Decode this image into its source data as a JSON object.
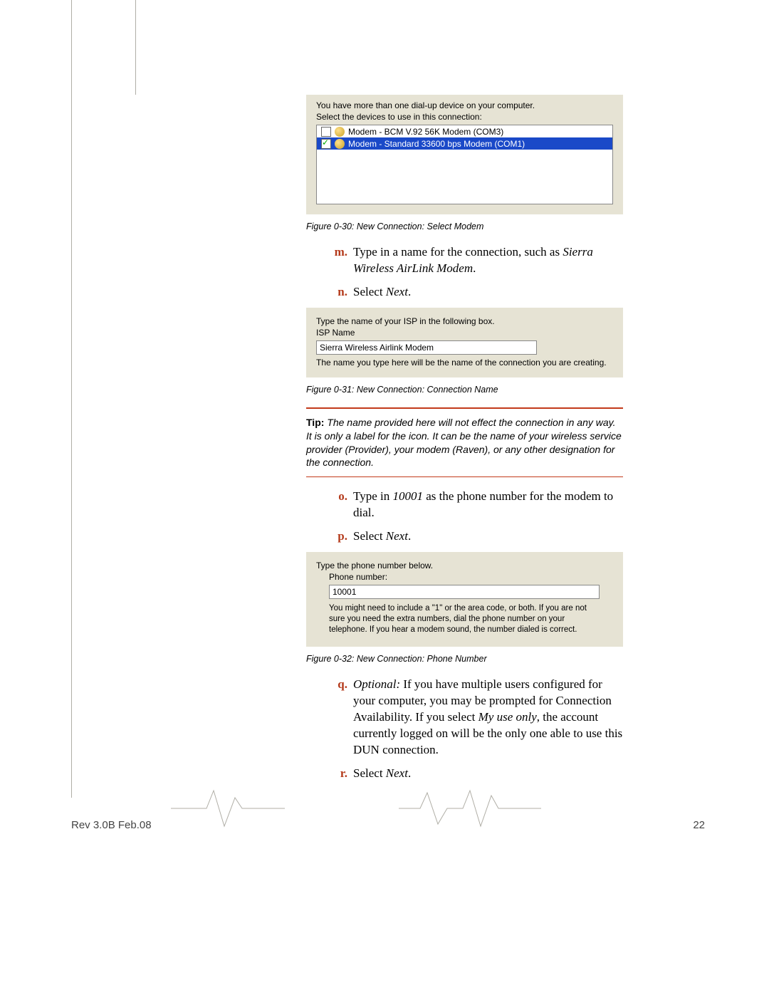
{
  "dlg1": {
    "line1": "You have more than one dial-up device on your computer.",
    "line2": "Select the devices to use in this connection:",
    "modem_a": "Modem - BCM V.92 56K Modem (COM3)",
    "modem_b": "Modem - Standard 33600 bps Modem (COM1)"
  },
  "cap30": "Figure 0-30: New Connection: Select Modem",
  "step_m_b": "m.",
  "step_m_t1": "Type in a name for the connection, such as ",
  "step_m_t2": "Sierra Wireless AirLink Modem",
  "step_m_t3": ".",
  "step_n_b": "n.",
  "step_n_t1": "Select ",
  "step_n_t2": "Next",
  "step_n_t3": ".",
  "dlg2": {
    "line1": "Type the name of your ISP in the following box.",
    "label": "ISP Name",
    "value": "Sierra Wireless Airlink Modem",
    "line2": "The name you type here will be the name of the connection you are creating."
  },
  "cap31": "Figure 0-31: New Connection: Connection Name",
  "tip_b": "Tip:",
  "tip_t": "The name provided here will not effect the connection in any way. It is only a label for the icon. It can be the name of your wireless service provider (Provider), your modem (Raven), or any other designation for the connection.",
  "step_o_b": "o.",
  "step_o_t1": "Type in ",
  "step_o_t2": "10001",
  "step_o_t3": " as the phone number for the modem to dial.",
  "step_p_b": "p.",
  "step_p_t1": "Select ",
  "step_p_t2": "Next",
  "step_p_t3": ".",
  "dlg3": {
    "line1": "Type the phone number below.",
    "label": "Phone number:",
    "value": "10001",
    "hint": "You might need to include a \"1\" or the area code, or both. If you are not sure you need the extra numbers, dial the phone number on your telephone. If you hear a modem sound, the number dialed is correct."
  },
  "cap32": "Figure 0-32: New Connection: Phone Number",
  "step_q_b": "q.",
  "step_q_t1": "Optional:",
  "step_q_t2": " If you have multiple users configured for your computer, you may be prompted for Connection Availability. If you select ",
  "step_q_t3": "My use only",
  "step_q_t4": ", the account currently logged on will be the only one able to use this DUN connection.",
  "step_r_b": "r.",
  "step_r_t1": "Select ",
  "step_r_t2": "Next",
  "step_r_t3": ".",
  "footer_rev": "Rev 3.0B  Feb.08",
  "footer_pg": "22"
}
